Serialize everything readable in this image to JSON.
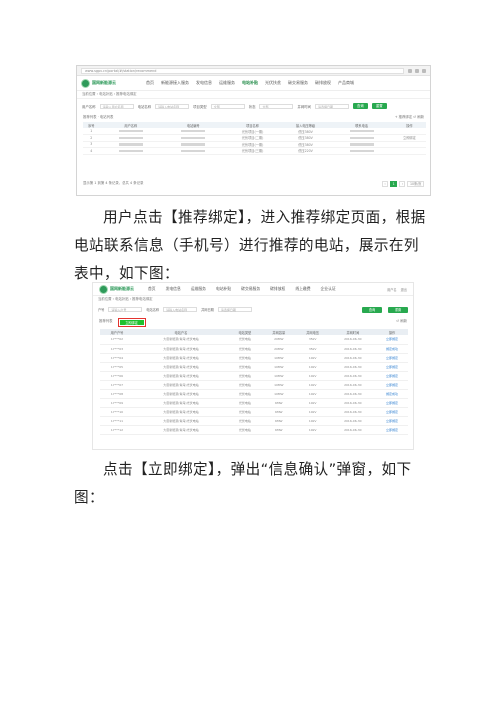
{
  "screenshot1": {
    "url": "www.sgpv.cn/portal/#/station/recommend",
    "logo_text": "国网新能源云",
    "menu": [
      "首页",
      "新能源接入服务",
      "发电信息",
      "运维服务",
      "电站补贴",
      "光伏扶贫",
      "碳交易服务",
      "碳排放权",
      "产品商城"
    ],
    "active_menu": "电站补贴",
    "breadcrumb": "当前位置 › 电站补贴 › 推荐电站绑定",
    "filters": [
      {
        "label": "用户名称",
        "placeholder": "请输入用户名称"
      },
      {
        "label": "电站名称",
        "placeholder": "请输入电站名称"
      },
      {
        "label": "项目类型",
        "placeholder": "全部"
      },
      {
        "label": "状态",
        "placeholder": "全部"
      },
      {
        "label": "并网时间",
        "placeholder": "请选择日期"
      }
    ],
    "search_label": "查询",
    "reset_label": "重置",
    "toolbar_left": "推荐列表 · 电站列表",
    "toolbar_right": "+ 推荐绑定   ↺ 刷新",
    "columns": [
      "序号",
      "用户名称",
      "电站编号",
      "项目名称",
      "接入电压等级",
      "联系电话",
      "操作"
    ],
    "rows": [
      [
        "1",
        "",
        "",
        "光伏项目(一期)",
        "低压380V",
        "",
        ""
      ],
      [
        "2",
        "",
        "",
        "光伏项目(二期)",
        "低压380V",
        "",
        "立即绑定"
      ],
      [
        "3",
        "",
        "",
        "光伏项目(一期)",
        "低压380V",
        "",
        ""
      ],
      [
        "4",
        "",
        "",
        "光伏项目(三期)",
        "低压220V",
        "",
        ""
      ]
    ],
    "footer_text": "显示第 1 到第 4 条记录，总共 4 条记录",
    "pager": [
      "‹",
      "1",
      "›",
      "10条/页"
    ]
  },
  "paragraph1": "用户点击【推荐绑定】，进入推荐绑定页面，根据电站联系信息（手机号）进行推荐的电站，展示在列表中，如下图：",
  "screenshot2": {
    "logo_text": "国网新能源云",
    "menu": [
      "首页",
      "发电信息",
      "运维服务",
      "电站补贴",
      "碳交易服务",
      "碳排放权",
      "线上缴费",
      "企业认证"
    ],
    "user": [
      "用户名",
      "退出"
    ],
    "breadcrumb": "当前位置 › 电站补贴 › 推荐电站绑定",
    "filters": [
      {
        "label": "户号",
        "placeholder": "请输入户号"
      },
      {
        "label": "电站名称",
        "placeholder": "请输入电站名称"
      },
      {
        "label": "并网日期",
        "placeholder": "请选择日期"
      }
    ],
    "search_label": "查询",
    "reset_label": "重置",
    "toolbar_label": "推荐列表",
    "bind_label": "立即绑定",
    "toolbar_right": "↺ 刷新",
    "columns": [
      "用户户号",
      "电站户名",
      "电站类型",
      "并网容量",
      "并网电压",
      "并网时间",
      "操作"
    ],
    "rows": [
      [
        "17***02",
        "大唐新能源(青海)光伏电站",
        "光伏电站",
        "20MW",
        "35kV",
        "2016-06-30",
        "立即绑定"
      ],
      [
        "17***03",
        "大唐新能源(青海)光伏电站",
        "光伏电站",
        "20MW",
        "35kV",
        "2016-06-30",
        "绑定成功"
      ],
      [
        "17***04",
        "大唐新能源(青海)光伏电站",
        "光伏电站",
        "10MW",
        "10kV",
        "2016-06-30",
        "立即绑定"
      ],
      [
        "17***05",
        "大唐新能源(青海)光伏电站",
        "光伏电站",
        "10MW",
        "10kV",
        "2016-06-30",
        "立即绑定"
      ],
      [
        "17***06",
        "大唐新能源(青海)光伏电站",
        "光伏电站",
        "10MW",
        "10kV",
        "2016-06-30",
        "立即绑定"
      ],
      [
        "17***07",
        "大唐新能源(青海)光伏电站",
        "光伏电站",
        "10MW",
        "10kV",
        "2016-06-30",
        "立即绑定"
      ],
      [
        "17***08",
        "大唐新能源(青海)光伏电站",
        "光伏电站",
        "10MW",
        "10kV",
        "2016-06-30",
        "绑定成功"
      ],
      [
        "17***09",
        "大唐新能源(青海)光伏电站",
        "光伏电站",
        "6MW",
        "10kV",
        "2016-06-30",
        "立即绑定"
      ],
      [
        "17***10",
        "大唐新能源(青海)光伏电站",
        "光伏电站",
        "6MW",
        "10kV",
        "2016-06-30",
        "立即绑定"
      ],
      [
        "17***11",
        "大唐新能源(青海)光伏电站",
        "光伏电站",
        "6MW",
        "10kV",
        "2016-06-30",
        "立即绑定"
      ],
      [
        "17***12",
        "大唐新能源(青海)光伏电站",
        "光伏电站",
        "6MW",
        "10kV",
        "2016-06-30",
        "立即绑定"
      ]
    ]
  },
  "paragraph2": "点击【立即绑定】，弹出“信息确认”弹窗，如下图：",
  "colors": {
    "brand_green": "#28a94f",
    "highlight_red": "#e3342f",
    "link_blue": "#2f7fd0"
  }
}
